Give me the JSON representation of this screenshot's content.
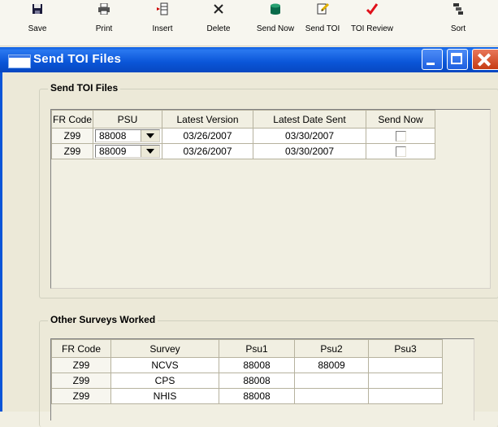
{
  "toolbar": {
    "buttons": [
      {
        "label": "Save",
        "icon": "floppy-disk-icon"
      },
      {
        "label": "Print",
        "icon": "printer-icon"
      },
      {
        "label": "Insert",
        "icon": "insert-row-icon"
      },
      {
        "label": "Delete",
        "icon": "delete-x-icon"
      },
      {
        "label": "Send Now",
        "icon": "database-cylinder-icon"
      },
      {
        "label": "Send TOI",
        "icon": "send-document-icon"
      },
      {
        "label": "TOI Review",
        "icon": "checkmark-icon"
      },
      {
        "label": "Sort",
        "icon": "sort-icon"
      }
    ]
  },
  "window": {
    "title": "Send TOI Files"
  },
  "send_toi": {
    "group_title": "Send TOI Files",
    "columns": [
      "FR Code",
      "PSU",
      "Latest Version",
      "Latest Date Sent",
      "Send Now"
    ],
    "rows": [
      {
        "fr_code": "Z99",
        "psu": "88008",
        "latest_version": "03/26/2007",
        "latest_date_sent": "03/30/2007",
        "send_now": false
      },
      {
        "fr_code": "Z99",
        "psu": "88009",
        "latest_version": "03/26/2007",
        "latest_date_sent": "03/30/2007",
        "send_now": false
      }
    ]
  },
  "other_surveys": {
    "group_title": "Other Surveys Worked",
    "columns": [
      "FR Code",
      "Survey",
      "Psu1",
      "Psu2",
      "Psu3"
    ],
    "rows": [
      {
        "fr_code": "Z99",
        "survey": "NCVS",
        "psu1": "88008",
        "psu2": "88009",
        "psu3": ""
      },
      {
        "fr_code": "Z99",
        "survey": "CPS",
        "psu1": "88008",
        "psu2": "",
        "psu3": ""
      },
      {
        "fr_code": "Z99",
        "survey": "NHIS",
        "psu1": "88008",
        "psu2": "",
        "psu3": ""
      }
    ]
  },
  "colors": {
    "titlebar": "#0a55d8",
    "close_button": "#c63b12",
    "window_bg": "#ece9d8"
  }
}
